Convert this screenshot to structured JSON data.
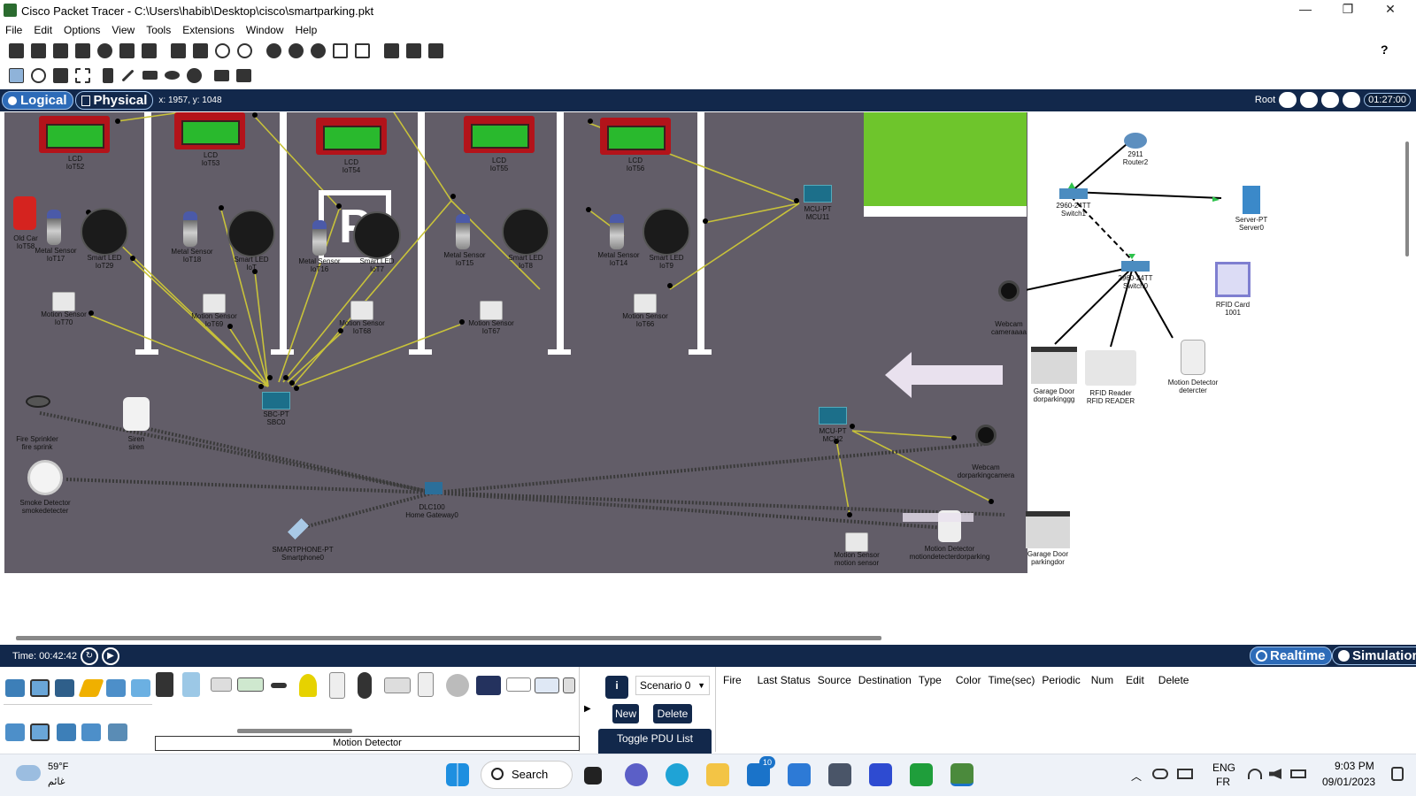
{
  "window": {
    "title": "Cisco Packet Tracer - C:\\Users\\habib\\Desktop\\cisco\\smartparking.pkt",
    "minimize": "—",
    "maximize": "❐",
    "close": "✕"
  },
  "menu": [
    "File",
    "Edit",
    "Options",
    "View",
    "Tools",
    "Extensions",
    "Window",
    "Help"
  ],
  "help_icon": "?",
  "nav": {
    "logical": "Logical",
    "physical": "Physical",
    "coords": "x: 1957, y: 1048",
    "root": "Root",
    "clock": "01:27:00"
  },
  "devices": {
    "lcd1": "LCD\nIoT52",
    "lcd2": "LCD\nIoT53",
    "lcd3": "LCD\nIoT54",
    "lcd4": "LCD\nIoT55",
    "lcd5": "LCD\nIoT56",
    "oldcar": "Old Car\nIoT58",
    "ms17": "Metal Sensor\nIoT17",
    "ms18": "Metal Sensor\nIoT18",
    "ms16": "Metal Sensor\nIoT16",
    "ms15": "Metal Sensor\nIoT15",
    "ms14": "Metal Sensor\nIoT14",
    "led29": "Smart LED\nIoT29",
    "led1x": "Smart LED\nIoT",
    "led7": "Smart LED\nIoT7",
    "led8": "Smart LED\nIoT8",
    "led9": "Smart LED\nIoT9",
    "mot70": "Motion Sensor\nIoT70",
    "mot69": "Motion Sensor\nIoT69",
    "mot68": "Motion Sensor\nIoT68",
    "mot67": "Motion Sensor\nIoT67",
    "mot66": "Motion Sensor\nIoT66",
    "mcu11": "MCU-PT\nMCU11",
    "sbc": "SBC-PT\nSBC0",
    "sprinkler": "Fire Sprinkler\nfire sprink",
    "siren": "Siren\nsiren",
    "smoke": "Smoke Detector\nsmokedetecter",
    "gateway": "DLC100\nHome Gateway0",
    "phone": "SMARTPHONE-PT\nSmartphone0",
    "mcu2": "MCU-PT\nMCU2",
    "webcam2": "Webcam\ndorparkingcamera",
    "motsensor": "Motion Sensor\nmotion sensor",
    "motdet2": "Motion Detector\nmotiondetecterdorparking",
    "garage2": "Garage Door\nparkingdor",
    "router": "2911\nRouter2",
    "switch1": "2960-24TT\nSwitch1",
    "server": "Server-PT\nServer0",
    "switch0": "2960-24TT\nSwitch0",
    "rfidcard": "RFID Card\n1001",
    "webcam1": "Webcam\ncameraaaa",
    "garage1": "Garage Door\ndorparkinggg",
    "rfidreader": "RFID Reader\nRFID READER",
    "motdet1": "Motion Detector\ndetercter",
    "p_sign": "P"
  },
  "bottom": {
    "time": "Time: 00:42:42",
    "realtime": "Realtime",
    "simulation": "Simulation"
  },
  "device_panel": {
    "selected": "Motion Detector"
  },
  "scenario": {
    "info": "i",
    "select": "Scenario 0",
    "new": "New",
    "delete": "Delete",
    "toggle": "Toggle PDU List Window"
  },
  "pdu_headers": [
    "Fire",
    "Last Status",
    "Source",
    "Destination",
    "Type",
    "Color",
    "Time(sec)",
    "Periodic",
    "Num",
    "Edit",
    "Delete"
  ],
  "taskbar": {
    "temp": "59°F",
    "weather_desc": "غائم",
    "search": "Search",
    "mail_badge": "10",
    "lang1": "ENG",
    "lang2": "FR",
    "time": "9:03 PM",
    "date": "09/01/2023"
  },
  "colors": {
    "workspace": "#625d68",
    "navbar": "#12284b",
    "link": "#c8c23a"
  }
}
